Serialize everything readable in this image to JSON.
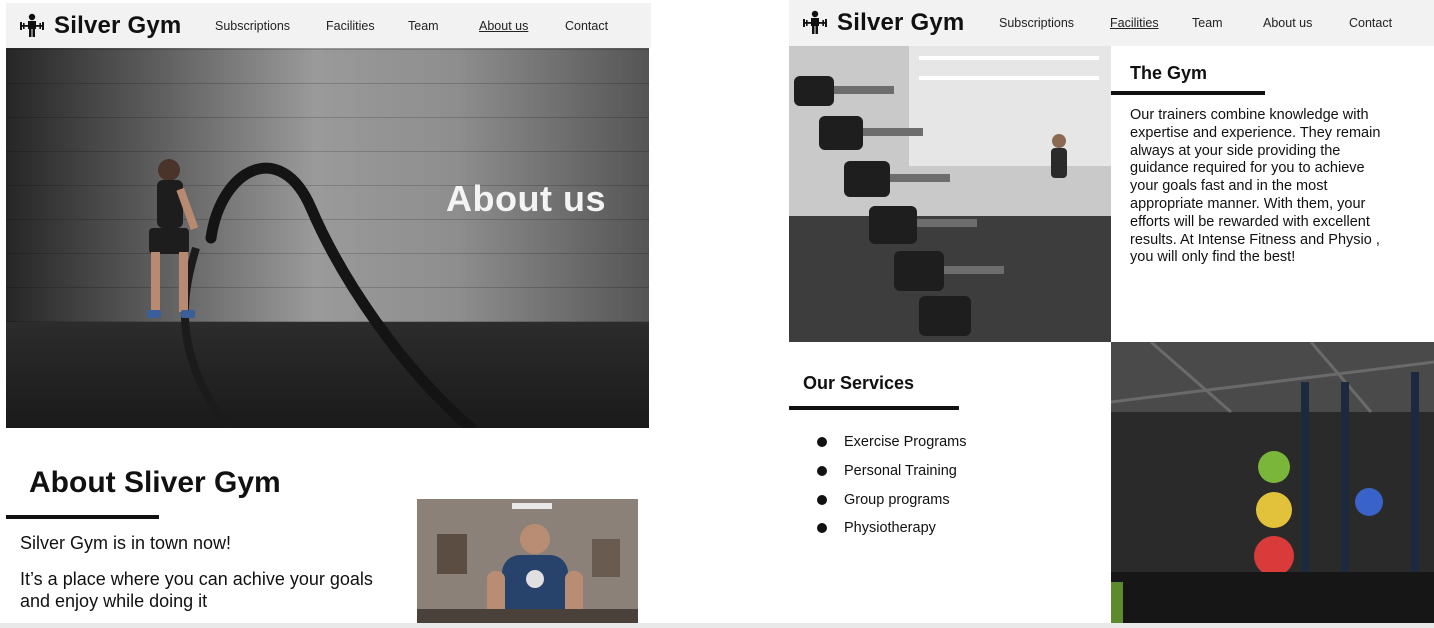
{
  "brand": {
    "name": "Silver Gym"
  },
  "nav_left": {
    "links": [
      {
        "label": "Subscriptions",
        "active": false
      },
      {
        "label": "Facilities",
        "active": false
      },
      {
        "label": "Team",
        "active": false
      },
      {
        "label": "About us",
        "active": true
      },
      {
        "label": "Contact",
        "active": false
      }
    ]
  },
  "hero": {
    "title": "About us"
  },
  "about": {
    "title": "About Sliver Gym",
    "paragraph1": "Silver Gym is in town now!",
    "paragraph2": "It’s a place where you can achive your goals and enjoy while doing it"
  },
  "nav_right": {
    "links": [
      {
        "label": "Subscriptions",
        "active": false
      },
      {
        "label": "Facilities",
        "active": true
      },
      {
        "label": "Team",
        "active": false
      },
      {
        "label": "About us",
        "active": false
      },
      {
        "label": "Contact",
        "active": false
      }
    ]
  },
  "the_gym": {
    "title": "The Gym",
    "text": "Our trainers combine knowledge with expertise and experience. They remain always at your side providing the guidance required for you to achieve your goals fast and in the most appropriate manner. With them, your efforts will be rewarded with excellent results. At Intense Fitness and Physio , you will only find the best!"
  },
  "services": {
    "title": "Our Services",
    "items": [
      "Exercise Programs",
      "Personal Training",
      "Group programs",
      "Physiotherapy"
    ]
  },
  "colors": {
    "nav_bg": "#f2f2f2",
    "text": "#111111",
    "divider": "#111111"
  }
}
